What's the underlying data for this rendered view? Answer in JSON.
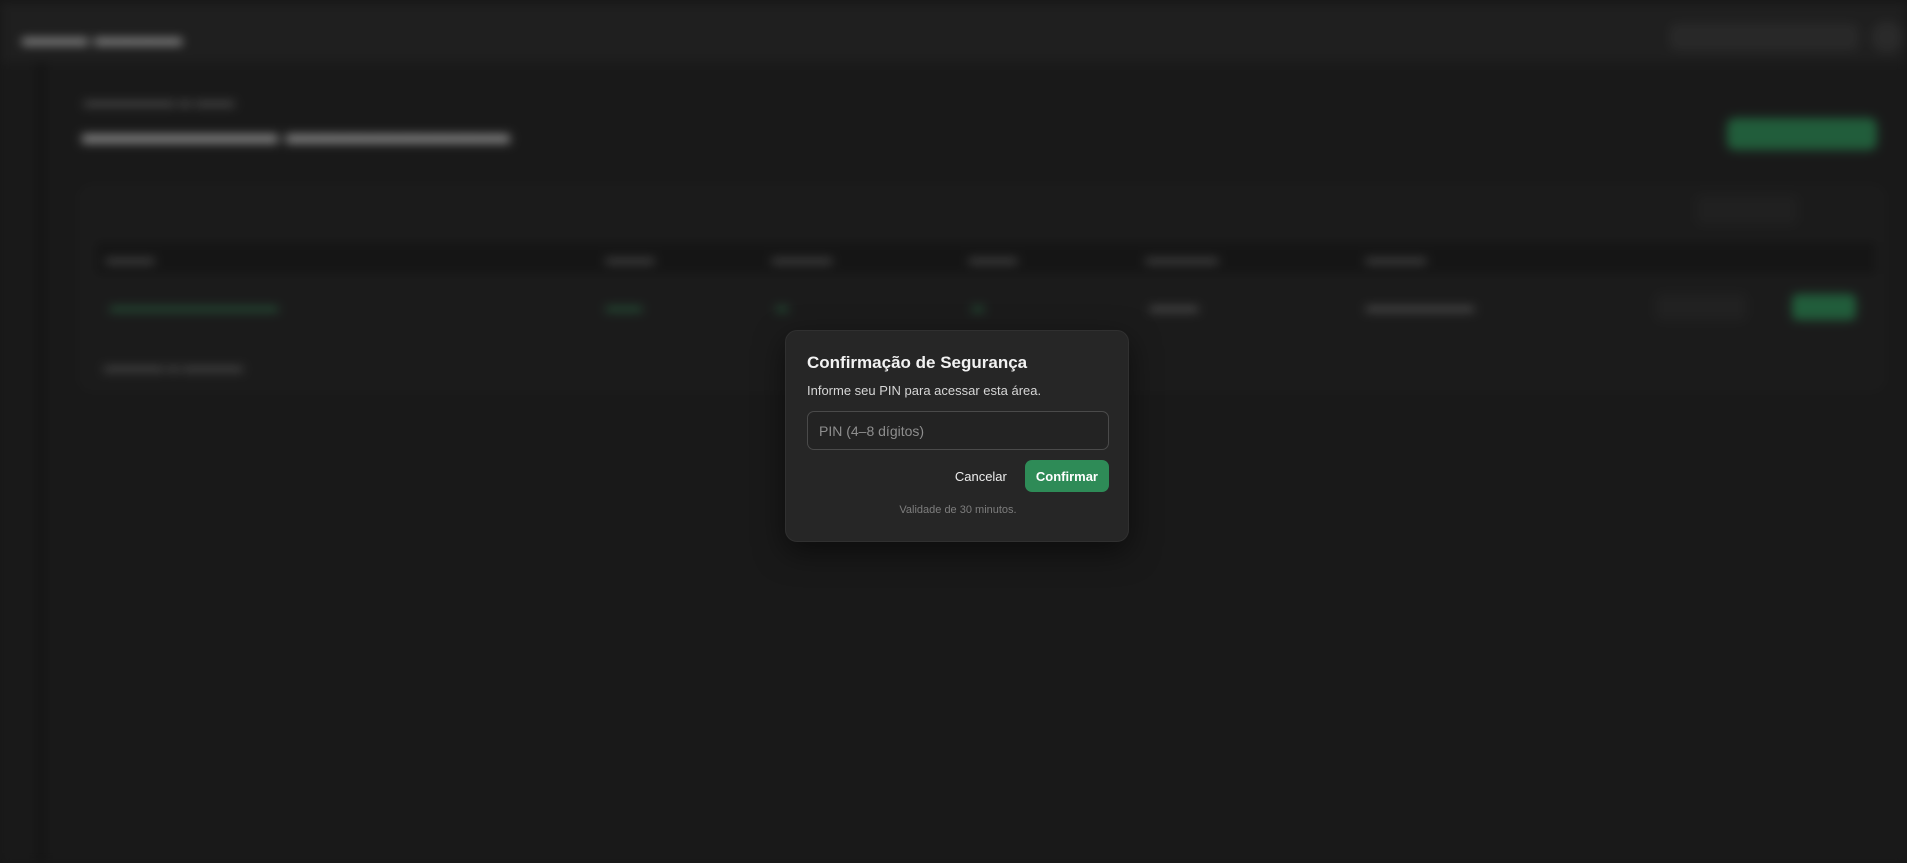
{
  "colors": {
    "accent": "#2e8b57",
    "background": "#1f1f1f",
    "modal_bg": "#262626"
  },
  "modal": {
    "title": "Confirmação de Segurança",
    "description": "Informe seu PIN para acessar esta área.",
    "pin_placeholder": "PIN (4–8 dígitos)",
    "pin_value": "",
    "cancel_label": "Cancelar",
    "confirm_label": "Confirmar",
    "validity_note": "Validade de 30 minutos."
  }
}
